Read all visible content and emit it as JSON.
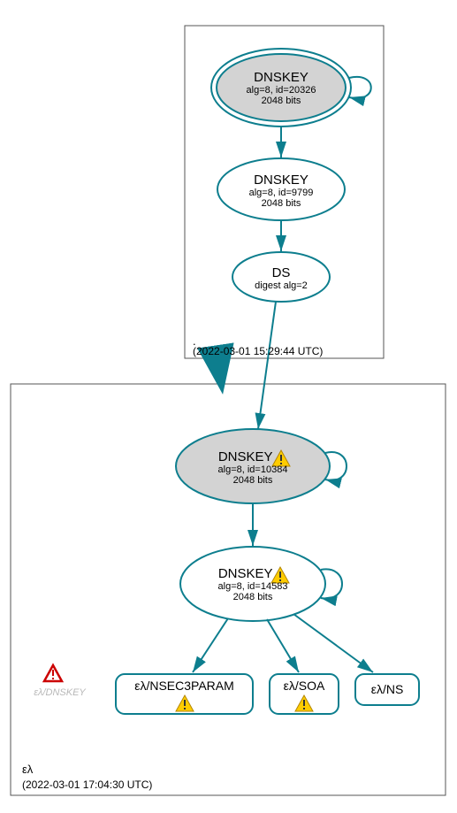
{
  "zone1": {
    "name": ".",
    "timestamp": "(2022-03-01 15:29:44 UTC)"
  },
  "zone2": {
    "name": "ελ",
    "timestamp": "(2022-03-01 17:04:30 UTC)"
  },
  "node_ksk_root": {
    "title": "DNSKEY",
    "detail": "alg=8, id=20326",
    "bits": "2048 bits"
  },
  "node_zsk_root": {
    "title": "DNSKEY",
    "detail": "alg=8, id=9799",
    "bits": "2048 bits"
  },
  "node_ds": {
    "title": "DS",
    "detail": "digest alg=2"
  },
  "node_ksk_el": {
    "title": "DNSKEY",
    "detail": "alg=8, id=10384",
    "bits": "2048 bits"
  },
  "node_zsk_el": {
    "title": "DNSKEY",
    "detail": "alg=8, id=14583",
    "bits": "2048 bits"
  },
  "rr_nsec3": {
    "label": "ελ/NSEC3PARAM"
  },
  "rr_soa": {
    "label": "ελ/SOA"
  },
  "rr_ns": {
    "label": "ελ/NS"
  },
  "alias": {
    "label": "ελ/DNSKEY"
  }
}
